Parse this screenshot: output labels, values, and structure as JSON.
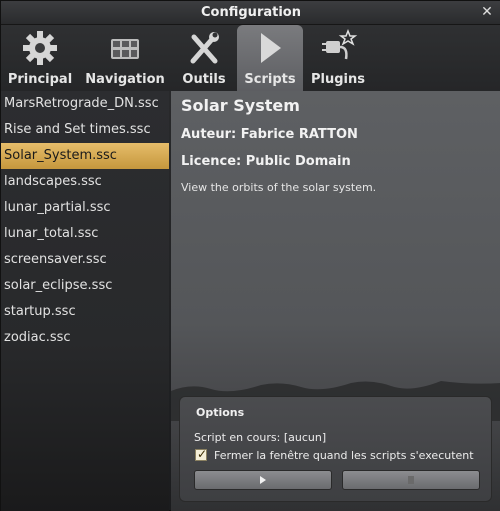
{
  "window": {
    "title": "Configuration",
    "close_label": "✕"
  },
  "tabs": [
    {
      "label": "Principal",
      "icon": "gear-icon"
    },
    {
      "label": "Navigation",
      "icon": "navigation-grid-icon"
    },
    {
      "label": "Outils",
      "icon": "tools-icon"
    },
    {
      "label": "Scripts",
      "icon": "play-icon",
      "active": true
    },
    {
      "label": "Plugins",
      "icon": "plug-icon"
    }
  ],
  "scripts": {
    "items": [
      "MarsRetrograde_DN.ssc",
      "Rise and Set times.ssc",
      "Solar_System.ssc",
      "landscapes.ssc",
      "lunar_partial.ssc",
      "lunar_total.ssc",
      "screensaver.ssc",
      "solar_eclipse.ssc",
      "startup.ssc",
      "zodiac.ssc"
    ],
    "selected_index": 2
  },
  "details": {
    "title": "Solar System",
    "author": "Auteur: Fabrice RATTON",
    "license": "Licence: Public Domain",
    "description": "View the orbits of the solar system."
  },
  "options": {
    "title": "Options",
    "running": "Script en cours: [aucun]",
    "close_window_label": "Fermer la fenêtre quand les scripts s'executent",
    "close_window_checked": true
  },
  "colors": {
    "selection": "#d8ab52",
    "active_tab": "#6b6c70",
    "background": "#2b2c2e"
  }
}
